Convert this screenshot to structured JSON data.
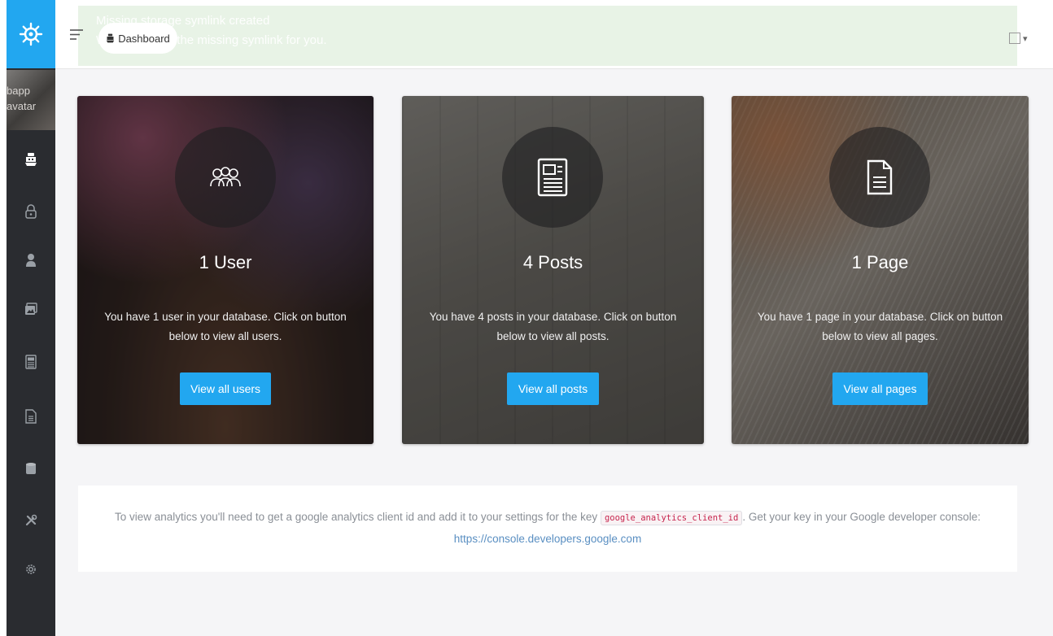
{
  "alert": {
    "title": "Missing storage symlink created",
    "message": "We've created the missing symlink for you."
  },
  "breadcrumb": {
    "label": "Dashboard"
  },
  "sidebar": {
    "avatar_alt_line1": "bapp",
    "avatar_alt_line2": "avatar",
    "items": [
      {
        "icon": "boat-icon"
      },
      {
        "icon": "lock-icon"
      },
      {
        "icon": "person-icon"
      },
      {
        "icon": "images-icon"
      },
      {
        "icon": "news-icon"
      },
      {
        "icon": "file-icon"
      },
      {
        "icon": "database-icon"
      },
      {
        "icon": "tools-icon"
      },
      {
        "icon": "settings-icon"
      }
    ]
  },
  "cards": {
    "users": {
      "title": "1 User",
      "text": "You have 1 user in your database. Click on button below to view all users.",
      "button": "View all users"
    },
    "posts": {
      "title": "4 Posts",
      "text": "You have 4 posts in your database. Click on button below to view all posts.",
      "button": "View all posts"
    },
    "pages": {
      "title": "1 Page",
      "text": "You have 1 page in your database. Click on button below to view all pages.",
      "button": "View all pages"
    }
  },
  "analytics": {
    "text_before": "To view analytics you'll need to get a google analytics client id and add it to your settings for the key",
    "key": "google_analytics_client_id",
    "text_after": ". Get your key in your Google developer console:",
    "link": "https://console.developers.google.com"
  },
  "colors": {
    "accent": "#22a7f0",
    "sidebar": "#2a2c30",
    "alert_bg": "#e8f3e6"
  }
}
